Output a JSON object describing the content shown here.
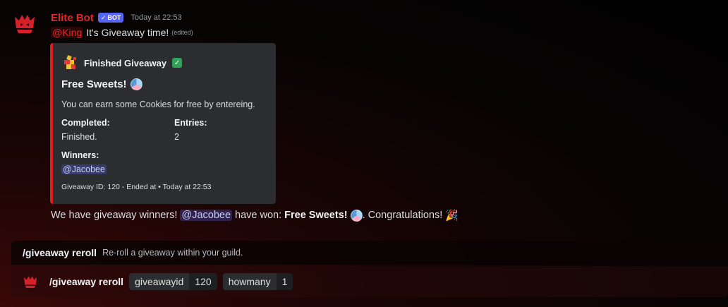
{
  "message": {
    "username": "Elite Bot",
    "bot_tag": "BOT",
    "timestamp": "Today at 22:53",
    "mention": "@King",
    "text": "It's Giveaway time!",
    "edited": "(edited)"
  },
  "embed": {
    "author": "Finished Giveaway",
    "title": "Free Sweets!",
    "description": "You can earn some Cookies for free by entereing.",
    "fields": {
      "completed_name": "Completed:",
      "completed_value": "Finished.",
      "entries_name": "Entries:",
      "entries_value": "2",
      "winners_name": "Winners:",
      "winners_value": "@Jacobee"
    },
    "footer": "Giveaway ID: 120 - Ended at • Today at 22:53",
    "accent_color": "#da2020"
  },
  "winners_message": {
    "prefix": "We have giveaway winners!",
    "mention": "@Jacobee",
    "middle": "have won:",
    "prize": "Free Sweets!",
    "suffix": ". Congratulations!"
  },
  "command_hint": {
    "name": "/giveaway reroll",
    "description": "Re-roll a giveaway within your guild."
  },
  "command_bar": {
    "name": "/giveaway reroll",
    "options": [
      {
        "key": "giveawayid",
        "value": "120"
      },
      {
        "key": "howmany",
        "value": "1"
      }
    ]
  },
  "colors": {
    "brand_red": "#e0272a",
    "bot_tag": "#5865f2",
    "embed_bg": "#2b2d31"
  }
}
